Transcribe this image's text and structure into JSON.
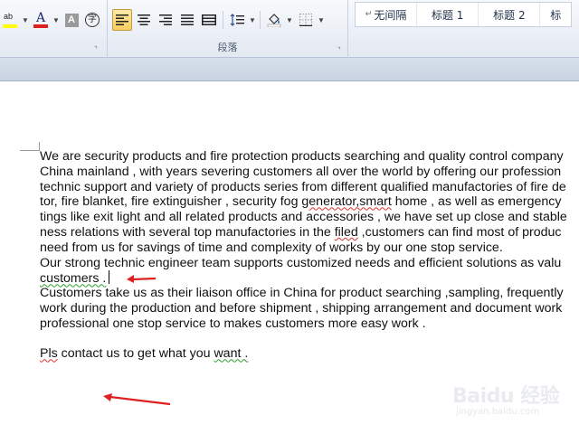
{
  "ribbon": {
    "font_group": {
      "highlight_label": "ab",
      "font_color_label": "A",
      "char_shading_label": "A",
      "enclose_char_label": "字"
    },
    "paragraph_group": {
      "label": "段落"
    },
    "styles_group": {
      "items": [
        {
          "mark": "↵",
          "label": "无间隔"
        },
        {
          "label": "标题 1"
        },
        {
          "label": "标题 2"
        },
        {
          "label": "标"
        }
      ]
    },
    "launcher_glyph": "⌝"
  },
  "document": {
    "lines": [
      "We are security products and fire protection products searching and quality control company",
      "China mainland  , with years severing customers all over the world by offering our profession",
      "technic support and variety of products series from different qualified manufactories of fire de",
      "tor, fire blanket, fire extinguisher , security fog ",
      "tings like exit light and all related products and accessories , we have set up close and stable",
      "ness relations with several top manufactories in the ",
      "need from us for savings of time and complexity of works by our one stop service.",
      "Our strong technic engineer team supports customized needs and efficient solutions as valu",
      "customers .",
      "Customers take us as their liaison office in China for product searching ,sampling, frequently",
      "work during the production and before shipment , shipping arrangement and document work",
      "professional one stop service to makes customers more easy work ."
    ],
    "line4_red": "generator,smart",
    "line4_tail": " home , as well as emergency",
    "line6_red": "filed",
    "line6_tail": " ,customers can find most of produc",
    "contact_prefix": "Pls",
    "contact_mid": " contact us to get what you ",
    "contact_green": "want .",
    "accent_color": "#e02020"
  },
  "watermark": {
    "title": "Baidu 经验",
    "sub": "jingyan.baidu.com"
  }
}
